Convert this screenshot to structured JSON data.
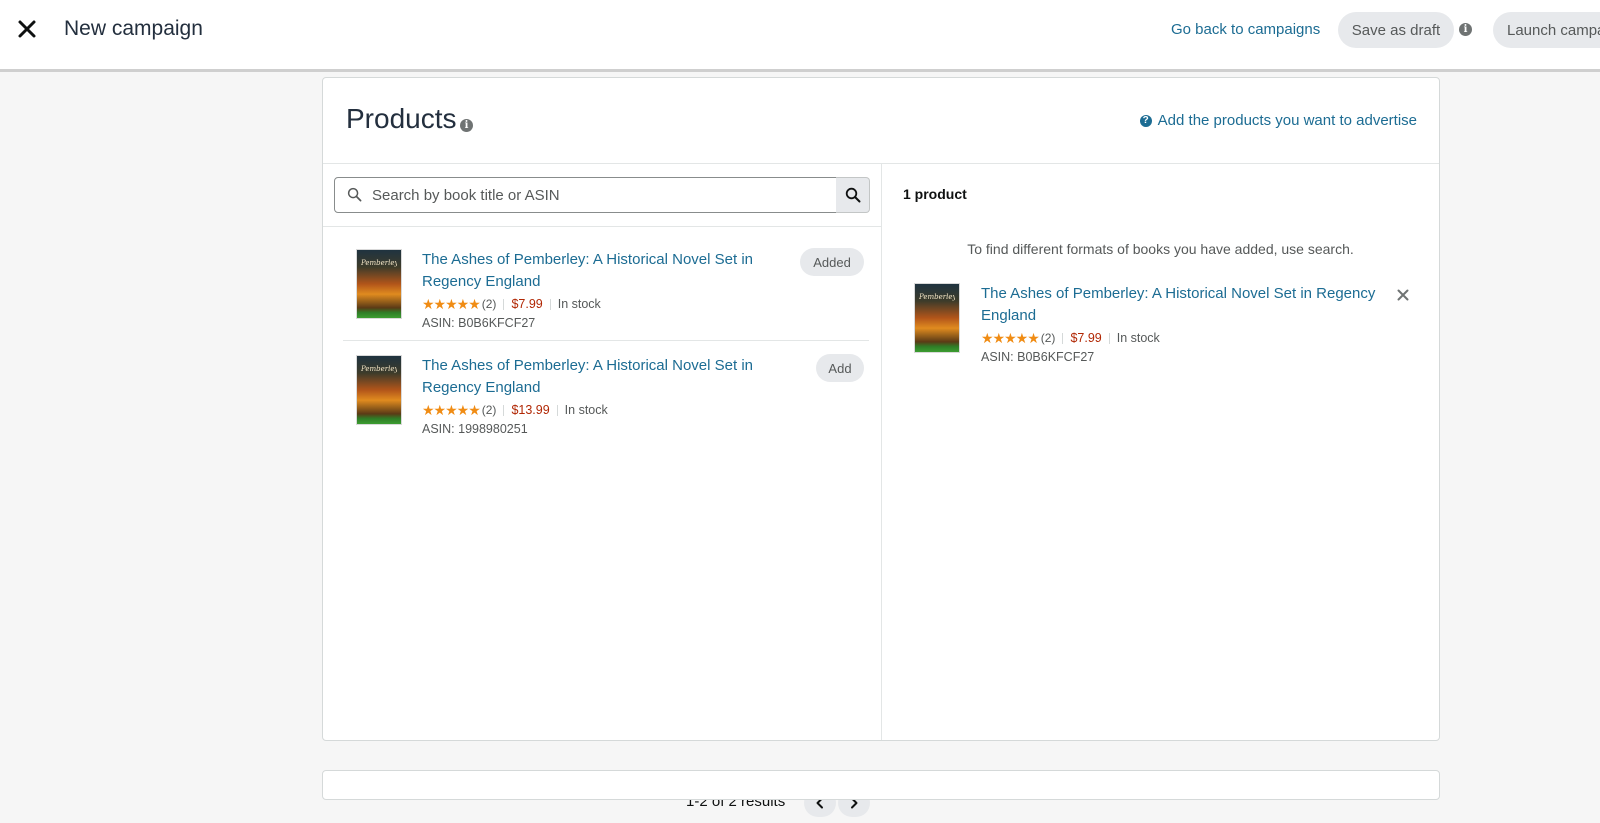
{
  "header": {
    "title": "New campaign",
    "back_link": "Go back to campaigns",
    "save_draft": "Save as draft",
    "launch": "Launch campa"
  },
  "products": {
    "title": "Products",
    "help_link": "Add the products you want to advertise",
    "search": {
      "placeholder": "Search by book title or ASIN",
      "value": ""
    },
    "results": [
      {
        "title": "The Ashes of Pemberley: A Historical Novel Set in Regency England",
        "stars": "★★★★★",
        "rating_count": "(2)",
        "price": "$7.99",
        "availability": "In stock",
        "asin": "ASIN: B0B6KFCF27",
        "action": "Added"
      },
      {
        "title": "The Ashes of Pemberley: A Historical Novel Set in Regency England",
        "stars": "★★★★★",
        "rating_count": "(2)",
        "price": "$13.99",
        "availability": "In stock",
        "asin": "ASIN: 1998980251",
        "action": "Add"
      }
    ],
    "pagination": {
      "summary": "1-2 of 2 results"
    },
    "selected": {
      "count_label": "1 product",
      "formats_note": "To find different formats of books you have added, use search.",
      "items": [
        {
          "title": "The Ashes of Pemberley: A Historical Novel Set in Regency England",
          "stars": "★★★★★",
          "rating_count": "(2)",
          "price": "$7.99",
          "availability": "In stock",
          "asin": "ASIN: B0B6KFCF27"
        }
      ]
    }
  },
  "icons": {
    "close": "close-icon",
    "info": "info-icon",
    "help": "help-circle-icon",
    "search": "search-icon",
    "prev": "chevron-left-icon",
    "next": "chevron-right-icon",
    "remove": "remove-icon"
  },
  "colors": {
    "link": "#1c6c93",
    "star": "#f08c14",
    "price": "#b12704",
    "pill_bg": "#e7e9ec",
    "page_bg": "#f6f6f6"
  }
}
